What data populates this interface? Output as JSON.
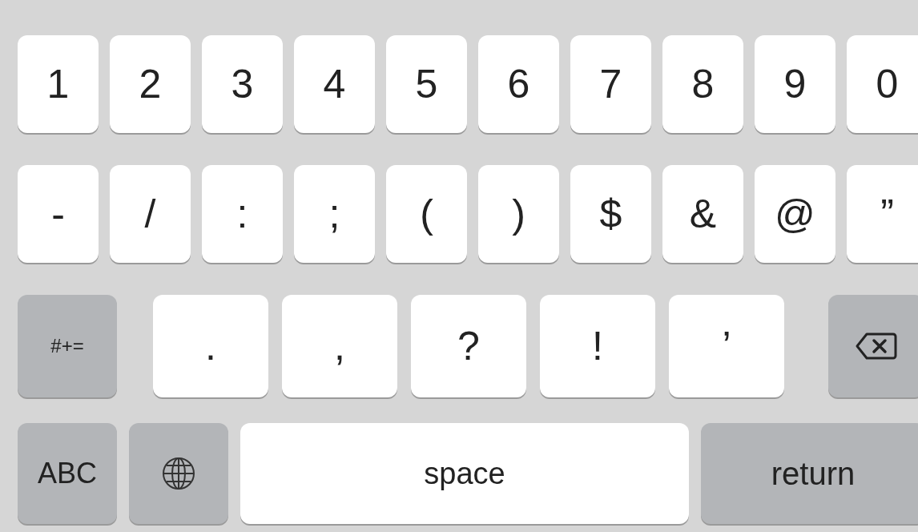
{
  "keyboard": {
    "rows": [
      {
        "kind": "digits",
        "keys": [
          {
            "kind": "char",
            "label": "1"
          },
          {
            "kind": "char",
            "label": "2"
          },
          {
            "kind": "char",
            "label": "3"
          },
          {
            "kind": "char",
            "label": "4"
          },
          {
            "kind": "char",
            "label": "5"
          },
          {
            "kind": "char",
            "label": "6"
          },
          {
            "kind": "char",
            "label": "7"
          },
          {
            "kind": "char",
            "label": "8"
          },
          {
            "kind": "char",
            "label": "9"
          },
          {
            "kind": "char",
            "label": "0"
          }
        ]
      },
      {
        "kind": "digits",
        "keys": [
          {
            "kind": "char",
            "label": "-"
          },
          {
            "kind": "char",
            "label": "/"
          },
          {
            "kind": "char",
            "label": ":"
          },
          {
            "kind": "char",
            "label": ";"
          },
          {
            "kind": "char",
            "label": "("
          },
          {
            "kind": "char",
            "label": ")"
          },
          {
            "kind": "char",
            "label": "$"
          },
          {
            "kind": "char",
            "label": "&"
          },
          {
            "kind": "char",
            "label": "@"
          },
          {
            "kind": "char",
            "label": "”"
          }
        ]
      },
      {
        "kind": "punct",
        "keys": [
          {
            "kind": "mode",
            "label": "#+="
          },
          {
            "kind": "wide",
            "label": "."
          },
          {
            "kind": "wide",
            "label": ","
          },
          {
            "kind": "wide",
            "label": "?"
          },
          {
            "kind": "wide",
            "label": "!"
          },
          {
            "kind": "wide",
            "label": "’"
          },
          {
            "kind": "backspace"
          }
        ]
      },
      {
        "kind": "bottom",
        "keys": [
          {
            "kind": "mode",
            "label": "ABC"
          },
          {
            "kind": "globe"
          },
          {
            "kind": "space",
            "label": "space"
          },
          {
            "kind": "return",
            "label": "return"
          }
        ]
      }
    ]
  }
}
